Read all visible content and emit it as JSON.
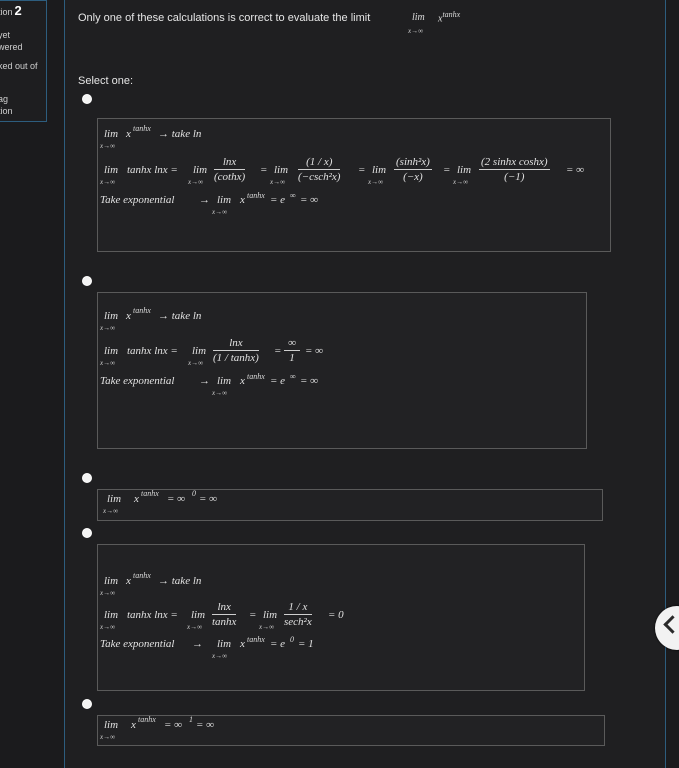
{
  "question_info": {
    "question_prefix": "tion",
    "question_number": "2",
    "status_line1": "yet",
    "status_line2": "wered",
    "marks_label": "ked out of",
    "flag_line1": "ag",
    "flag_line2": "tion"
  },
  "question": {
    "text": "Only one of these calculations is correct to evaluate the limit",
    "limit": "lim",
    "limit_sub": "x→∞",
    "base": "x",
    "exponent": "tanhx"
  },
  "select_label": "Select one:",
  "options": [
    {
      "line1": {
        "lim": "lim",
        "sub": "x→∞",
        "base": "x",
        "exp": "tanhx",
        "rest": "→ take ln"
      },
      "line2": {
        "lim1": "lim",
        "sub1": "x→∞",
        "expr": "tanhx lnx =",
        "lim2": "lim",
        "sub2": "x→∞",
        "f1_num": "lnx",
        "f1_den": "(cothx)",
        "eq1": "=",
        "lim3": "lim",
        "sub3": "x→∞",
        "f2_num": "(1 / x)",
        "f2_den": "(−csch²x)",
        "eq2": "=",
        "lim4": "lim",
        "sub4": "x→∞",
        "f3_num": "(sinh²x)",
        "f3_den": "(−x)",
        "eq3": "=",
        "lim5": "lim",
        "sub5": "x→∞",
        "f4_num": "(2 sinhx coshx)",
        "f4_den": "(−1)",
        "result": "= ∞"
      },
      "line3": {
        "text": "Take exponential",
        "arrow": "→",
        "lim": "lim",
        "sub": "x→∞",
        "base": "x",
        "exp": "tanhx",
        "rest": "= e",
        "rest_exp": "∞",
        "rest2": "= ∞"
      }
    },
    {
      "line1": {
        "lim": "lim",
        "sub": "x→∞",
        "base": "x",
        "exp": "tanhx",
        "rest": "→ take ln"
      },
      "line2": {
        "lim1": "lim",
        "sub1": "x→∞",
        "expr": "tanhx lnx =",
        "lim2": "lim",
        "sub2": "x→∞",
        "f1_num": "lnx",
        "f1_den": "(1 / tanhx)",
        "eq1": "=",
        "f2_num": "∞",
        "f2_den": "1",
        "result": "= ∞"
      },
      "line3": {
        "text": "Take exponential",
        "arrow": "→",
        "lim": "lim",
        "sub": "x→∞",
        "base": "x",
        "exp": "tanhx",
        "rest": "= e",
        "rest_exp": "∞",
        "rest2": "= ∞"
      }
    },
    {
      "line1": {
        "lim": "lim",
        "sub": "x→∞",
        "base": "x",
        "exp": "tanhx",
        "rest": "= ∞",
        "rest_exp": "0",
        "rest2": "= ∞"
      }
    },
    {
      "line1": {
        "lim": "lim",
        "sub": "x→∞",
        "base": "x",
        "exp": "tanhx",
        "rest": "→ take ln"
      },
      "line2": {
        "lim1": "lim",
        "sub1": "x→∞",
        "expr": "tanhx lnx =",
        "lim2": "lim",
        "sub2": "x→∞",
        "f1_num": "lnx",
        "f1_den": "tanhx",
        "eq1": "=",
        "lim3": "lim",
        "sub3": "x→∞",
        "f2_num": "1 / x",
        "f2_den": "sech²x",
        "result": "= 0"
      },
      "line3": {
        "text": "Take exponential",
        "arrow": "→",
        "lim": "lim",
        "sub": "x→∞",
        "base": "x",
        "exp": "tanhx",
        "rest": "= e",
        "rest_exp": "0",
        "rest2": "= 1"
      }
    },
    {
      "line1": {
        "lim": "lim",
        "sub": "x→∞",
        "base": "x",
        "exp": "tanhx",
        "rest": "= ∞",
        "rest_exp": "1",
        "rest2": "= ∞"
      }
    }
  ],
  "nav": {
    "icon": "chevron-left-icon"
  }
}
